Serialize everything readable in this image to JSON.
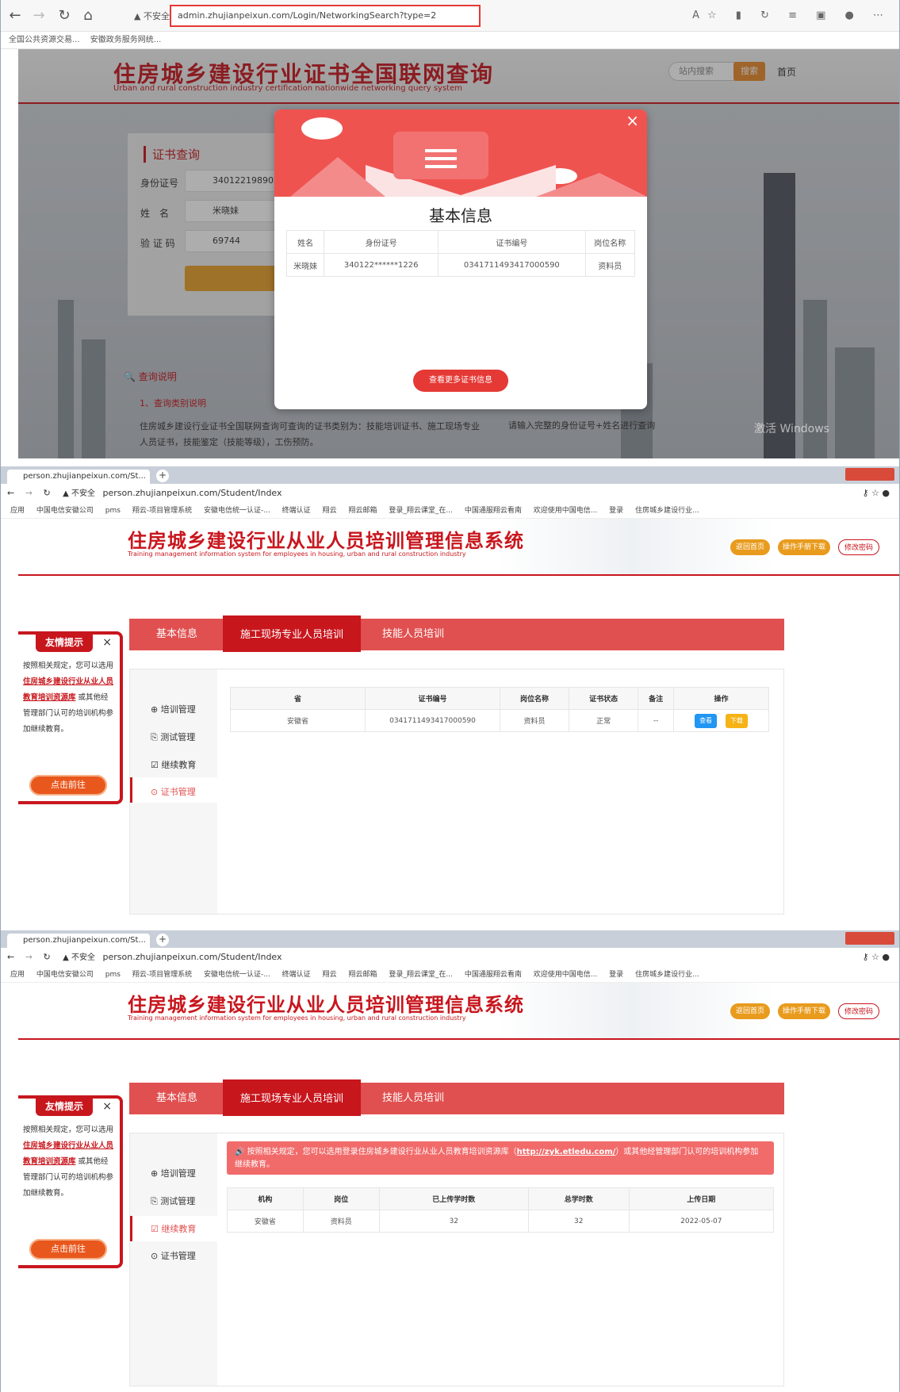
{
  "panelA": {
    "browser": {
      "warning": "不安全",
      "url": "admin.zhujianpeixun.com/Login/NetworkingSearch?type=2",
      "bookmarks": [
        "全国公共资源交易...",
        "安徽政务服务网统..."
      ]
    },
    "header": {
      "title": "住房城乡建设行业证书全国联网查询",
      "subtitle": "Urban and rural construction industry certification nationwide networking query system",
      "search_placeholder": "站内搜索",
      "search_button": "搜索",
      "home_link": "首页"
    },
    "query_card": {
      "title": "证书查询",
      "id_label": "身份证号",
      "id_value": "3401221989022",
      "name_label": "姓　名",
      "name_value": "米晓妹",
      "code_label": "验 证 码",
      "code_value": "69744"
    },
    "explain": {
      "title": "查询说明",
      "item1": "1、查询类别说明",
      "text": "住房城乡建设行业证书全国联网查询可查询的证书类别为：技能培训证书、施工现场专业人员证书，技能鉴定（技能等级），工伤预防。",
      "hint": "请输入完整的身份证号+姓名进行查询"
    },
    "watermark": "激活 Windows",
    "modal": {
      "title": "基本信息",
      "headers": [
        "姓名",
        "身份证号",
        "证书编号",
        "岗位名称"
      ],
      "row": [
        "米晓妹",
        "340122******1226",
        "0341711493417000590",
        "资料员"
      ],
      "more_button": "查看更多证书信息"
    }
  },
  "panelB": {
    "tab_title": "person.zhujianpeixun.com/St...",
    "warning": "不安全",
    "url": "person.zhujianpeixun.com/Student/Index",
    "bookmarks": [
      "应用",
      "中国电信安徽公司",
      "pms",
      "翔云-项目管理系统",
      "安徽电信统一认证-...",
      "终端认证",
      "翔云",
      "翔云邮箱",
      "登录_翔云课堂_在...",
      "中国通服翔云看南",
      "欢迎使用中国电信...",
      "登录",
      "住房城乡建设行业..."
    ],
    "banner": {
      "title": "住房城乡建设行业从业人员培训管理信息系统",
      "subtitle": "Training management information system for employees in housing, urban and rural construction industry",
      "btn_home": "返回首页",
      "btn_manual": "操作手册下载",
      "btn_pwd": "修改密码"
    },
    "nav": [
      "基本信息",
      "施工现场专业人员培训",
      "技能人员培训"
    ],
    "side": [
      "培训管理",
      "测试管理",
      "继续教育",
      "证书管理"
    ],
    "table": {
      "headers": [
        "省",
        "证书编号",
        "岗位名称",
        "证书状态",
        "备注",
        "操作"
      ],
      "row": [
        "安徽省",
        "0341711493417000590",
        "资料员",
        "正常",
        "--"
      ],
      "btn_view": "查看",
      "btn_download": "下载"
    },
    "tip": {
      "title": "友情提示",
      "text1": "按照相关规定，您可以选用",
      "link": "住房城乡建设行业从业人员教育培训资源库",
      "text2": "或其他经管理部门认可的培训机构参加继续教育。",
      "button": "点击前往"
    }
  },
  "panelC": {
    "tab_title": "person.zhujianpeixun.com/St...",
    "warning": "不安全",
    "url": "person.zhujianpeixun.com/Student/Index",
    "notice_text": "按照相关规定，您可以选用登录住房城乡建设行业从业人员教育培训资源库（",
    "notice_link": "http://zyk.etledu.com/",
    "notice_text2": "）或其他经管理部门认可的培训机构参加继续教育。",
    "table": {
      "headers": [
        "机构",
        "岗位",
        "已上传学时数",
        "总学时数",
        "上传日期"
      ],
      "row": [
        "安徽省",
        "资料员",
        "32",
        "32",
        "2022-05-07"
      ]
    }
  },
  "colors": {
    "brand_red": "#c8161d",
    "nav_red": "#e15050",
    "accent_orange": "#e89b1d",
    "view_blue": "#2196f3"
  }
}
